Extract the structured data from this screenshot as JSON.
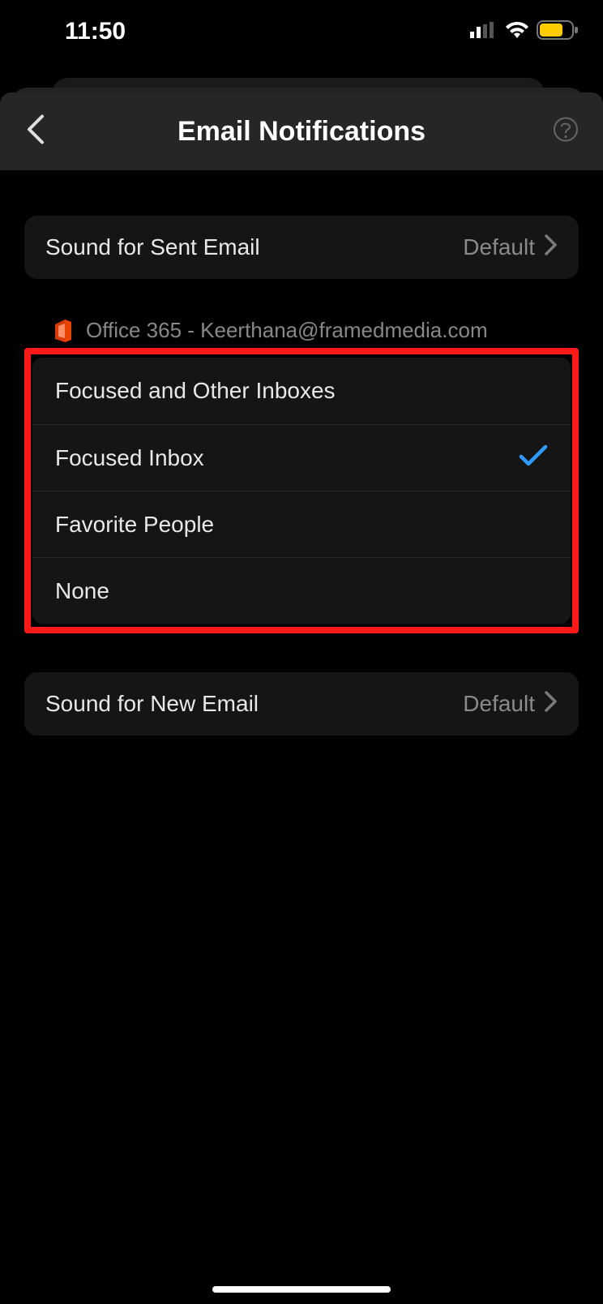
{
  "status": {
    "time": "11:50"
  },
  "header": {
    "title": "Email Notifications"
  },
  "sound_sent": {
    "label": "Sound for Sent Email",
    "value": "Default"
  },
  "account": {
    "label": "Office 365 - Keerthana@framedmedia.com"
  },
  "options": {
    "focused_other": "Focused and Other Inboxes",
    "focused": "Focused Inbox",
    "favorite": "Favorite People",
    "none": "None",
    "selected": "focused"
  },
  "sound_new": {
    "label": "Sound for New Email",
    "value": "Default"
  }
}
